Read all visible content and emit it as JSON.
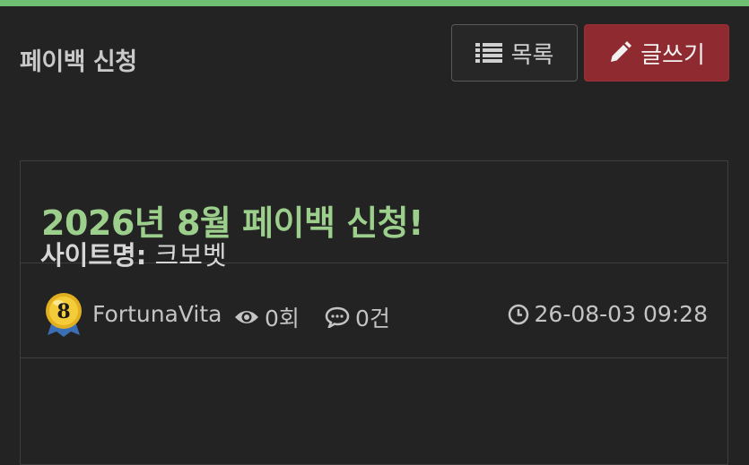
{
  "header": {
    "title": "페이백 신청",
    "list_button": "목록",
    "write_button": "글쓰기"
  },
  "post": {
    "title": "2026년 8월 페이백 신청!",
    "author": "FortunaVita",
    "author_level": "8",
    "views": "0회",
    "comments": "0건",
    "date": "26-08-03 09:28",
    "content_label": "사이트명:",
    "content_value": "크보벳"
  },
  "colors": {
    "accent_bar": "#6fbf73",
    "title_green": "#9ccf8c",
    "write_button": "#8e2a30"
  }
}
